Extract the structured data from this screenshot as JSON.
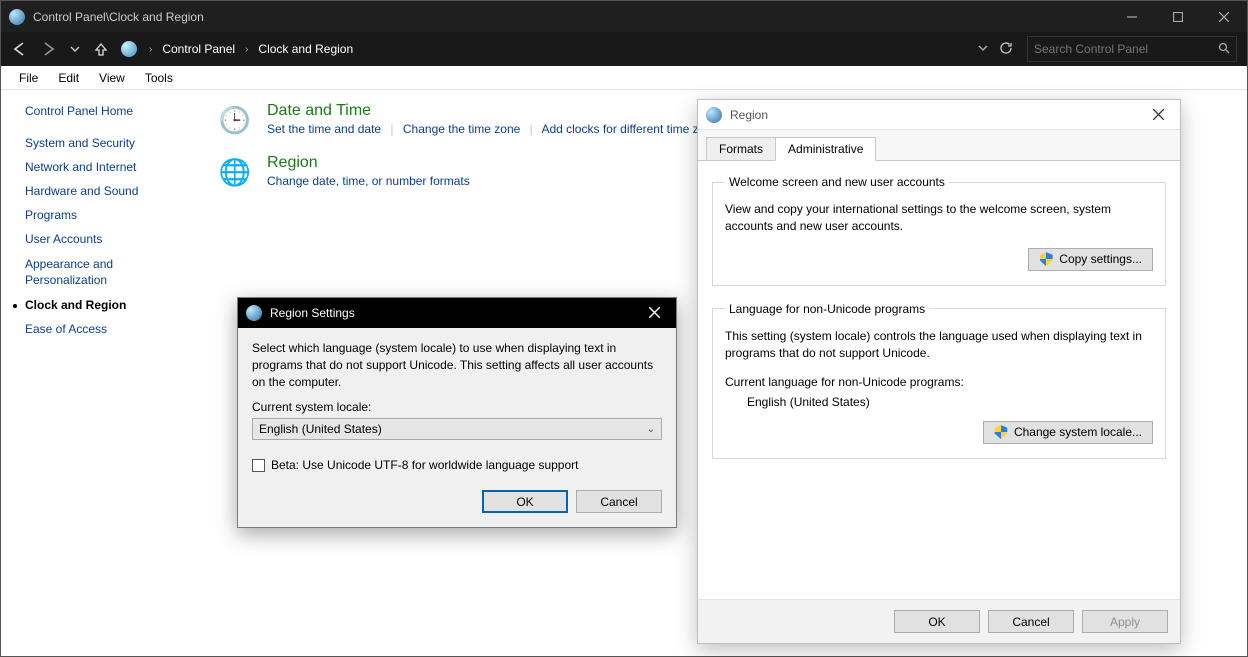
{
  "titlebar": {
    "caption": "Control Panel\\Clock and Region"
  },
  "nav": {
    "segments": [
      "Control Panel",
      "Clock and Region"
    ],
    "search_placeholder": "Search Control Panel"
  },
  "menu": [
    "File",
    "Edit",
    "View",
    "Tools"
  ],
  "sidebar": {
    "home": "Control Panel Home",
    "items": [
      "System and Security",
      "Network and Internet",
      "Hardware and Sound",
      "Programs",
      "User Accounts",
      "Appearance and Personalization",
      "Clock and Region",
      "Ease of Access"
    ],
    "active_index": 6
  },
  "categories": {
    "datetime": {
      "title": "Date and Time",
      "links": [
        "Set the time and date",
        "Change the time zone",
        "Add clocks for different time zones"
      ]
    },
    "region": {
      "title": "Region",
      "subtitle": "Change date, time, or number formats"
    }
  },
  "region_settings_popup": {
    "title": "Region Settings",
    "desc": "Select which language (system locale) to use when displaying text in programs that do not support Unicode. This setting affects all user accounts on the computer.",
    "locale_label": "Current system locale:",
    "locale_value": "English (United States)",
    "beta_label": "Beta: Use Unicode UTF-8 for worldwide language support",
    "ok": "OK",
    "cancel": "Cancel"
  },
  "region_window": {
    "title": "Region",
    "tabs": [
      "Formats",
      "Administrative"
    ],
    "active_tab": 1,
    "group_welcome": {
      "legend": "Welcome screen and new user accounts",
      "text": "View and copy your international settings to the welcome screen, system accounts and new user accounts.",
      "button": "Copy settings..."
    },
    "group_nonunicode": {
      "legend": "Language for non-Unicode programs",
      "text": "This setting (system locale) controls the language used when displaying text in programs that do not support Unicode.",
      "current_label": "Current language for non-Unicode programs:",
      "current_value": "English (United States)",
      "button": "Change system locale..."
    },
    "footer": {
      "ok": "OK",
      "cancel": "Cancel",
      "apply": "Apply"
    }
  }
}
